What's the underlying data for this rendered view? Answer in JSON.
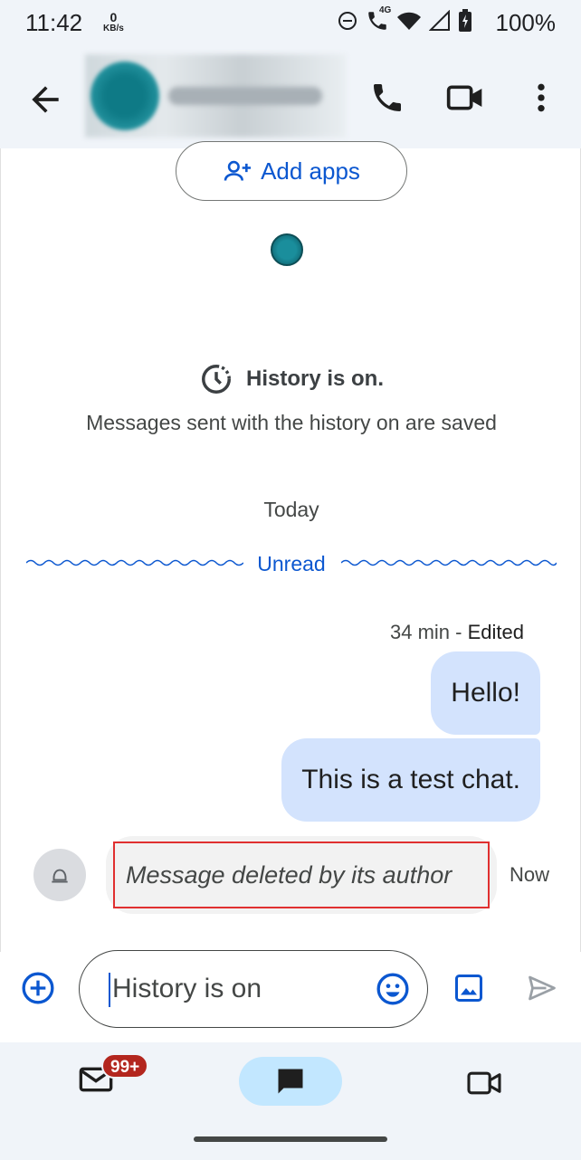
{
  "status_bar": {
    "time": "11:42",
    "net_speed_value": "0",
    "net_speed_unit": "KB/s",
    "network_label": "4G",
    "battery_text": "100%"
  },
  "app_bar": {
    "back_icon": "arrow-back-icon",
    "call_icon": "phone-icon",
    "video_icon": "videocam-icon",
    "more_icon": "more-vert-icon"
  },
  "chat": {
    "add_apps_label": "Add apps",
    "history_title": "History is on.",
    "history_subtitle": "Messages sent with the history on are saved",
    "date_separator": "Today",
    "unread_label": "Unread",
    "message_meta_time": "34 min",
    "message_meta_sep": " - ",
    "message_meta_edited": "Edited",
    "messages": [
      {
        "text": "Hello!",
        "direction": "outgoing"
      },
      {
        "text": "This is a test chat.",
        "direction": "outgoing"
      }
    ],
    "deleted_message": "Message deleted by its author",
    "deleted_time": "Now"
  },
  "composer": {
    "input_value": "History is on"
  },
  "bottom_nav": {
    "mail_badge": "99+"
  },
  "colors": {
    "accent": "#0b57d0",
    "bubble": "#d3e3fd",
    "surface": "#f0f4f9",
    "badge": "#b3261e",
    "nav_active": "#c2e7ff"
  }
}
